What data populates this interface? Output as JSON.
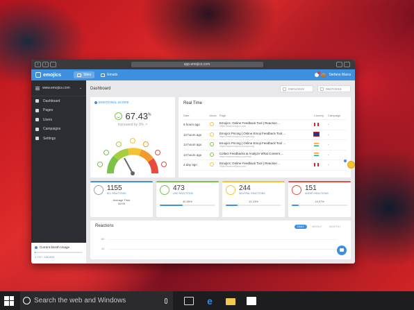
{
  "browser": {
    "url": "app.emojics.com"
  },
  "app": {
    "logo": "emojics",
    "tabs": [
      {
        "label": "Sites",
        "active": true
      },
      {
        "label": "Emails",
        "active": false
      }
    ],
    "user": "Stefano Marra",
    "accent_color": "#3d8fe0"
  },
  "sidebar": {
    "site": "www.emojics.com",
    "items": [
      {
        "label": "Dashboard",
        "icon": "dashboard-icon"
      },
      {
        "label": "Pages",
        "icon": "pages-icon"
      },
      {
        "label": "Users",
        "icon": "users-icon"
      },
      {
        "label": "Campaigns",
        "icon": "campaigns-icon"
      },
      {
        "label": "Settings",
        "icon": "settings-icon"
      }
    ],
    "usage": {
      "label": "Current Month Usage",
      "value": "1,737 / 100,000"
    }
  },
  "dashboard": {
    "title": "Dashboard",
    "date_from": "03/01/2019",
    "date_to": "06/27/2019"
  },
  "score": {
    "label": "EMOTIONAL SCORE",
    "value": "67.43",
    "unit": "%",
    "trend": "Increased by 3%"
  },
  "realtime": {
    "title": "Real Time",
    "headers": [
      "Date",
      "Mood",
      "Page",
      "Country",
      "Campaign"
    ],
    "rows": [
      {
        "date": "6 hours ago",
        "mood": "neutral",
        "page": "Emojics: Online Feedback Tool | Reaction ...",
        "url": "https://www.emojics.com",
        "country": "CA",
        "campaign": "-"
      },
      {
        "date": "12 hours ago",
        "mood": "neutral",
        "page": "Emojics Pricing | Online Emoji Feedback Tool ...",
        "url": "https://www.emojics.com/pricing/",
        "country": "GB",
        "campaign": "-"
      },
      {
        "date": "14 hours ago",
        "mood": "happy",
        "page": "Emojics Pricing | Online Emoji Feedback Tool ...",
        "url": "https://www.emojics.com/pricing/",
        "country": "IN",
        "campaign": "-"
      },
      {
        "date": "14 hours ago",
        "mood": "happy",
        "page": "Collect Feedbacks & Analyze What Content ...",
        "url": "https://www.emojics.com/feat/",
        "country": "IN",
        "campaign": "-"
      },
      {
        "date": "a day ago",
        "mood": "neutral",
        "page": "Emojics: Online Feedback Tool | Reaction ...",
        "url": "https://www.emojics.com",
        "country": "CA",
        "campaign": "-"
      }
    ]
  },
  "reaction_cards": [
    {
      "count": "1155",
      "label": "ALL REACTIONS",
      "footer_label": "Average Time",
      "footer_value": "00:09",
      "color": "#9aa0a8",
      "percent": null
    },
    {
      "count": "473",
      "label": "LIKE REACTIONS",
      "footer_value": "40.95%",
      "color": "#7cc14a",
      "percent": 40.95
    },
    {
      "count": "244",
      "label": "NEUTRAL REACTIONS",
      "footer_value": "21.13%",
      "color": "#f4c430",
      "percent": 21.13
    },
    {
      "count": "151",
      "label": "ANGRY REACTIONS",
      "footer_value": "13.07%",
      "color": "#e94b3c",
      "percent": 13.07
    }
  ],
  "reactions_chart": {
    "title": "Reactions",
    "periods": [
      {
        "label": "DAILY",
        "active": true
      },
      {
        "label": "WEEKLY",
        "active": false
      },
      {
        "label": "MONTHLY",
        "active": false
      }
    ],
    "y_ticks": [
      "60",
      "40"
    ]
  },
  "taskbar": {
    "search_placeholder": "Search the web and Windows"
  }
}
